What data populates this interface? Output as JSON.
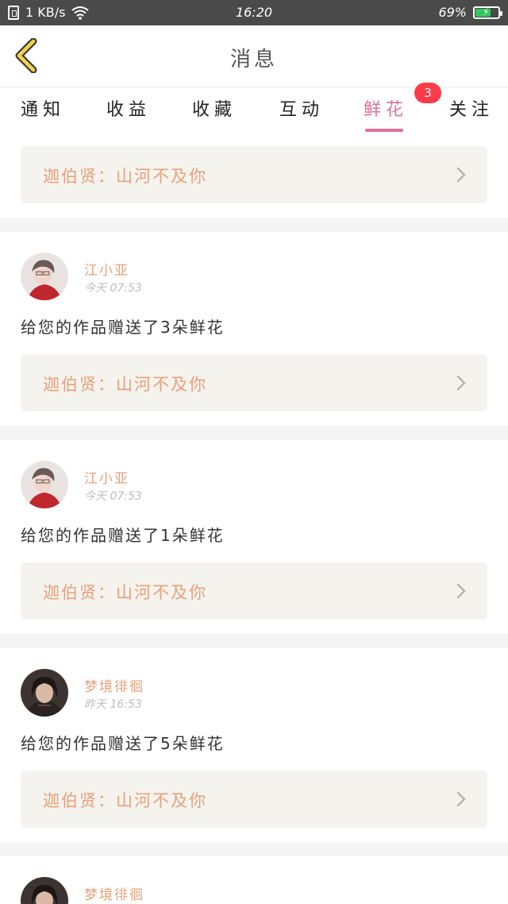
{
  "status_bar": {
    "speed": "1 KB/s",
    "time": "16:20",
    "battery": "69%",
    "battery_level": 0.69
  },
  "header": {
    "title": "消息",
    "back_icon": "chevron-left-icon"
  },
  "tabs": [
    {
      "label": "通知"
    },
    {
      "label": "收益"
    },
    {
      "label": "收藏"
    },
    {
      "label": "互动"
    },
    {
      "label": "鲜花",
      "active": true,
      "badge": "3"
    },
    {
      "label": "关注"
    }
  ],
  "top_item": {
    "work": "迦伯贤：山河不及你"
  },
  "items": [
    {
      "name": "江小亚",
      "time": "今天 07:53",
      "message": "给您的作品赠送了3朵鲜花",
      "work": "迦伯贤：山河不及你"
    },
    {
      "name": "江小亚",
      "time": "今天 07:53",
      "message": "给您的作品赠送了1朵鲜花",
      "work": "迦伯贤：山河不及你"
    },
    {
      "name": "梦境徘徊",
      "time": "昨天 16:53",
      "message": "给您的作品赠送了5朵鲜花",
      "work": "迦伯贤：山河不及你"
    },
    {
      "name": "梦境徘徊",
      "time": "",
      "message": "",
      "work": ""
    }
  ],
  "colors": {
    "accent": "#e0709b",
    "name": "#e8a07a",
    "badge": "#ff3b4a",
    "status_bar": "#4a4a4a",
    "work_box": "#f4f3ee"
  }
}
